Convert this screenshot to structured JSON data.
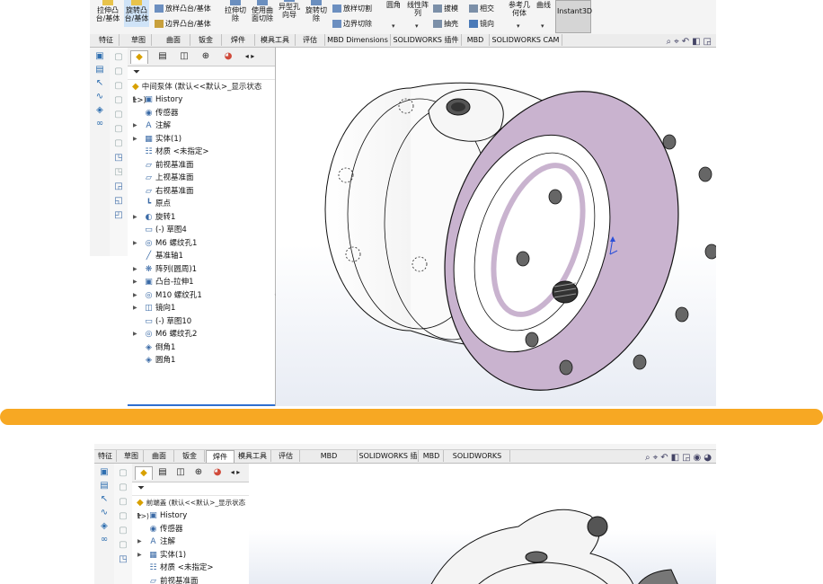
{
  "shot1": {
    "ribbon": {
      "big_buttons": [
        {
          "label_line1": "拉伸凸",
          "label_line2": "台/基体"
        },
        {
          "label_line1": "旋转凸",
          "label_line2": "台/基体"
        }
      ],
      "small_col1": [
        "放样凸台/基体",
        "边界凸台/基体"
      ],
      "mid_buttons": [
        {
          "label_line1": "拉伸切",
          "label_line2": "除"
        },
        {
          "label_line1": "使用曲",
          "label_line2": "面切除"
        },
        {
          "label_line1": "异型孔",
          "label_line2": "向导"
        },
        {
          "label_line1": "旋转切",
          "label_line2": "除"
        }
      ],
      "small_col2": [
        "放样切割",
        "边界切除"
      ],
      "fillet_label": "圆角",
      "pattern_label_line1": "线性阵",
      "pattern_label_line2": "列",
      "small_col3": [
        "拔模",
        "抽壳"
      ],
      "small_col4": [
        "相交",
        "镜向"
      ],
      "refgeo_line1": "参考几",
      "refgeo_line2": "何体",
      "curves_label": "曲线",
      "instant3d_label": "Instant3D"
    },
    "tabs": [
      "特征",
      "草图",
      "曲面",
      "钣金",
      "焊件",
      "模具工具",
      "评估",
      "MBD Dimensions",
      "SOLIDWORKS 插件",
      "MBD",
      "SOLIDWORKS CAM"
    ],
    "tree": {
      "root": "中间泵体  (默认<<默认>_显示状态 1>)",
      "nodes": [
        {
          "label": "History",
          "arrow": "▶",
          "icon": "▣"
        },
        {
          "label": "传感器",
          "arrow": "",
          "icon": "◉"
        },
        {
          "label": "注解",
          "arrow": "▶",
          "icon": "A"
        },
        {
          "label": "实体(1)",
          "arrow": "▶",
          "icon": "▦"
        },
        {
          "label": "材质 <未指定>",
          "arrow": "",
          "icon": "☷"
        },
        {
          "label": "前视基准面",
          "arrow": "",
          "icon": "▱"
        },
        {
          "label": "上视基准面",
          "arrow": "",
          "icon": "▱"
        },
        {
          "label": "右视基准面",
          "arrow": "",
          "icon": "▱"
        },
        {
          "label": "原点",
          "arrow": "",
          "icon": "┗"
        },
        {
          "label": "旋转1",
          "arrow": "▶",
          "icon": "◐"
        },
        {
          "label": "(-) 草图4",
          "arrow": "",
          "icon": "▭"
        },
        {
          "label": "M6 螺纹孔1",
          "arrow": "▶",
          "icon": "◎"
        },
        {
          "label": "基准轴1",
          "arrow": "",
          "icon": "╱"
        },
        {
          "label": "阵列(圆周)1",
          "arrow": "▶",
          "icon": "❋"
        },
        {
          "label": "凸台-拉伸1",
          "arrow": "▶",
          "icon": "▣"
        },
        {
          "label": "M10 螺纹孔1",
          "arrow": "▶",
          "icon": "◎"
        },
        {
          "label": "镜向1",
          "arrow": "▶",
          "icon": "◫"
        },
        {
          "label": "(-) 草图10",
          "arrow": "",
          "icon": "▭"
        },
        {
          "label": "M6 螺纹孔2",
          "arrow": "▶",
          "icon": "◎"
        },
        {
          "label": "倒角1",
          "arrow": "",
          "icon": "◈"
        },
        {
          "label": "圆角1",
          "arrow": "",
          "icon": "◈"
        }
      ]
    }
  },
  "shot2": {
    "tabs": [
      "特征",
      "草图",
      "曲面",
      "钣金",
      "焊件",
      "模具工具",
      "评估",
      "MBD Dimensions",
      "SOLIDWORKS 插件",
      "MBD",
      "SOLIDWORKS CAM"
    ],
    "tree": {
      "root": "前端盖  (默认<<默认>_显示状态 1>)",
      "nodes": [
        {
          "label": "History",
          "arrow": "▶",
          "icon": "▣"
        },
        {
          "label": "传感器",
          "arrow": "",
          "icon": "◉"
        },
        {
          "label": "注解",
          "arrow": "▶",
          "icon": "A"
        },
        {
          "label": "实体(1)",
          "arrow": "▶",
          "icon": "▦"
        },
        {
          "label": "材质 <未指定>",
          "arrow": "",
          "icon": "☷"
        },
        {
          "label": "前视基准面",
          "arrow": "",
          "icon": "▱"
        }
      ]
    }
  },
  "colors": {
    "divider": "#f7a823",
    "face_accent": "#c9b3cf",
    "selection": "#2f6fd0"
  }
}
